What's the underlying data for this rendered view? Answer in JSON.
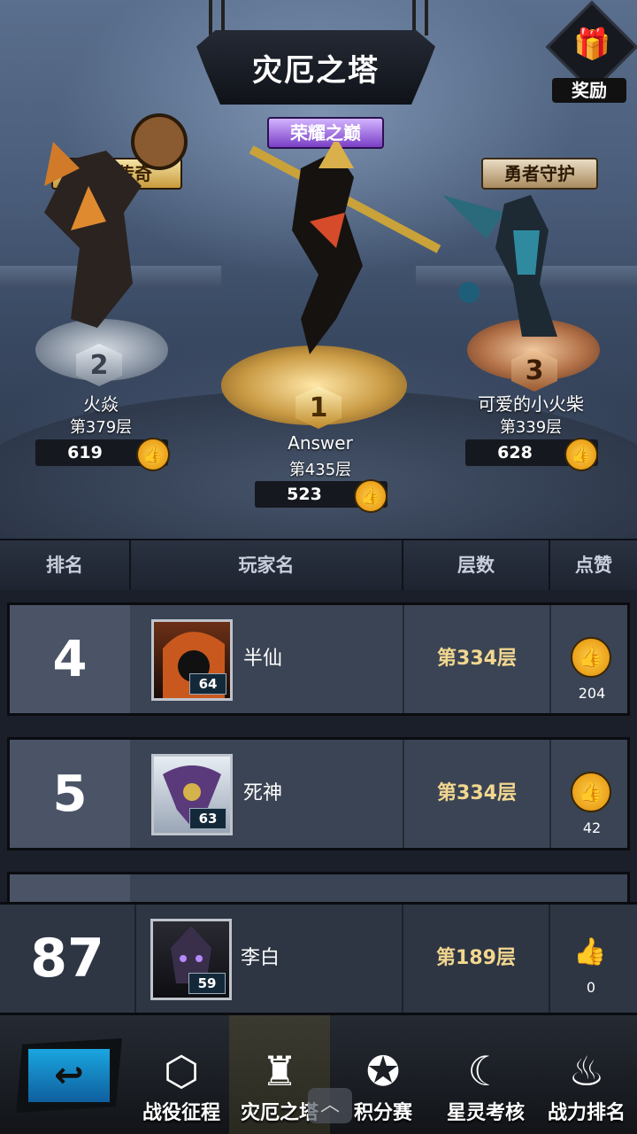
{
  "header": {
    "title": "灾厄之塔",
    "reward_label": "奖励",
    "reward_icon": "gift-icon"
  },
  "podium": {
    "first": {
      "badge": "荣耀之巅",
      "rank": "1",
      "name": "Answer",
      "floor": "第435层",
      "likes": "523"
    },
    "second": {
      "badge": "荣耀传奇",
      "rank": "2",
      "name": "火焱",
      "floor": "第379层",
      "likes": "619"
    },
    "third": {
      "badge": "勇者守护",
      "rank": "3",
      "name": "可爱的小火柴",
      "floor": "第339层",
      "likes": "628"
    }
  },
  "table": {
    "columns": [
      "排名",
      "玩家名",
      "层数",
      "点赞"
    ],
    "rows": [
      {
        "rank": "4",
        "name": "半仙",
        "level": "64",
        "floor": "第334层",
        "likes": "204"
      },
      {
        "rank": "5",
        "name": "死神",
        "level": "63",
        "floor": "第334层",
        "likes": "42"
      }
    ]
  },
  "self": {
    "rank": "87",
    "name": "李白",
    "level": "59",
    "floor": "第189层",
    "likes": "0"
  },
  "nav": {
    "items": [
      {
        "label": "战役征程",
        "icon": "hexagon-shield-icon"
      },
      {
        "label": "灾厄之塔",
        "icon": "tower-icon"
      },
      {
        "label": "积分赛",
        "icon": "star-emblem-icon"
      },
      {
        "label": "星灵考核",
        "icon": "moon-star-icon"
      },
      {
        "label": "战力排名",
        "icon": "flame-mask-icon"
      }
    ]
  },
  "colors": {
    "accent_gold": "#f2d78f",
    "thumb": "#e99d16",
    "back_blue": "#1aa6e0"
  }
}
